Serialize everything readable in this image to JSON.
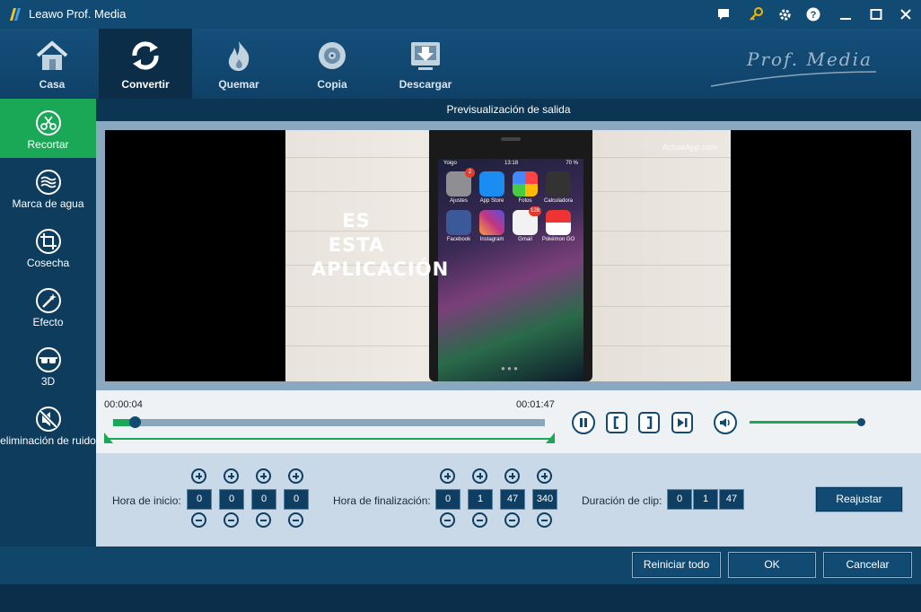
{
  "window": {
    "title": "Leawo Prof. Media",
    "controls": [
      "chat-icon",
      "key-icon",
      "gear-icon",
      "help-icon",
      "minimize-icon",
      "maximize-icon",
      "close-icon"
    ]
  },
  "nav": {
    "items": [
      {
        "label": "Casa",
        "icon": "home-icon"
      },
      {
        "label": "Convertir",
        "icon": "convert-icon",
        "active": true
      },
      {
        "label": "Quemar",
        "icon": "burn-icon"
      },
      {
        "label": "Copia",
        "icon": "copy-disc-icon"
      },
      {
        "label": "Descargar",
        "icon": "download-icon"
      }
    ],
    "brand": "Prof. Media"
  },
  "sidebar": {
    "items": [
      {
        "label": "Recortar",
        "icon": "scissors-icon",
        "active": true
      },
      {
        "label": "Marca de agua",
        "icon": "watermark-icon"
      },
      {
        "label": "Cosecha",
        "icon": "crop-icon"
      },
      {
        "label": "Efecto",
        "icon": "effect-icon"
      },
      {
        "label": "3D",
        "icon": "3d-glasses-icon"
      },
      {
        "label": "eliminación de ruido",
        "icon": "noise-removal-icon"
      }
    ]
  },
  "preview": {
    "header": "Previsualización de salida",
    "video_text": [
      "ES",
      "ESTA",
      "APLICACIÓN"
    ],
    "watermark": "ActualApp.com",
    "phone": {
      "carrier": "Yoigo",
      "clock": "13:18",
      "battery": "70 %",
      "apps": [
        {
          "name": "Ajustes",
          "badge": "2",
          "color": "#8e8e93"
        },
        {
          "name": "App Store",
          "badge": "",
          "color": "#1b8cf2"
        },
        {
          "name": "Fotos",
          "badge": "",
          "color": "#f5f5f5"
        },
        {
          "name": "Calculadora",
          "badge": "",
          "color": "#333333"
        },
        {
          "name": "Facebook",
          "badge": "",
          "color": "#3b5998"
        },
        {
          "name": "Instagram",
          "badge": "",
          "color": "#c13584"
        },
        {
          "name": "Gmail",
          "badge": "128",
          "color": "#f2f2f2"
        },
        {
          "name": "Pokémon GO",
          "badge": "",
          "color": "#e8e8e8"
        }
      ]
    }
  },
  "player": {
    "current_time": "00:00:04",
    "end_time": "00:01:47",
    "progress": 0.037,
    "volume": 1.0
  },
  "trim": {
    "start": {
      "label": "Hora de inicio:",
      "values": [
        "0",
        "0",
        "0",
        "0"
      ]
    },
    "end": {
      "label": "Hora de finalización:",
      "values": [
        "0",
        "1",
        "47",
        "340"
      ]
    },
    "duration": {
      "label": "Duración de clip:",
      "values": [
        "0",
        "1",
        "47"
      ]
    },
    "readjust_label": "Reajustar"
  },
  "footer": {
    "reset_label": "Reiniciar todo",
    "ok_label": "OK",
    "cancel_label": "Cancelar"
  },
  "colors": {
    "accent_green": "#1aa857",
    "primary_blue": "#114a72",
    "dark_blue": "#0b2d48"
  }
}
